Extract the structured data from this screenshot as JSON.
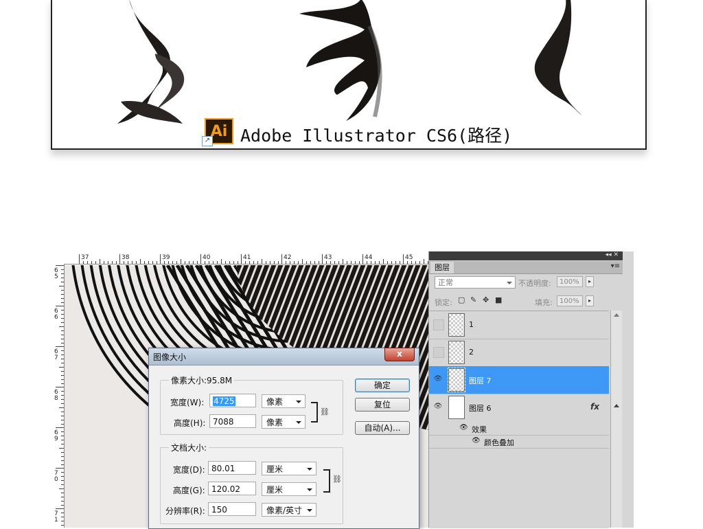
{
  "preview": {
    "app_label": "Adobe Illustrator CS6(路径)",
    "app_icon_text": "Ai",
    "app_icon": "illustrator-icon",
    "shortcut_icon": "shortcut-arrow-icon",
    "shortcut_glyph": "↗"
  },
  "rulers": {
    "top_ticks": [
      "37",
      "38",
      "39",
      "40",
      "41",
      "42",
      "43",
      "44",
      "45"
    ],
    "left_ticks": [
      [
        "6",
        "5"
      ],
      [
        "6",
        "6"
      ],
      [
        "6",
        "7"
      ],
      [
        "6",
        "8"
      ],
      [
        "6",
        "9"
      ],
      [
        "7",
        "0"
      ],
      [
        "7",
        "1"
      ]
    ]
  },
  "dialog": {
    "title": "图像大小",
    "close_glyph": "x",
    "pixel_dimensions": {
      "label": "像素大小:95.8M",
      "width_label": "宽度(W):",
      "width_value": "4725",
      "width_unit": "像素",
      "height_label": "高度(H):",
      "height_value": "7088",
      "height_unit": "像素"
    },
    "document_size": {
      "label": "文档大小:",
      "width_label": "宽度(D):",
      "width_value": "80.01",
      "width_unit": "厘米",
      "height_label": "高度(G):",
      "height_value": "120.02",
      "height_unit": "厘米",
      "resolution_label": "分辨率(R):",
      "resolution_value": "150",
      "resolution_unit": "像素/英寸"
    },
    "buttons": {
      "ok": "确定",
      "reset": "复位",
      "auto": "自动(A)..."
    }
  },
  "layers_panel": {
    "top_icons": "◂◂ ✕",
    "tab": "图层",
    "menu_glyph": "▾≡",
    "blend_mode": "正常",
    "opacity_label": "不透明度:",
    "opacity_value": "100%",
    "lock_label": "锁定:",
    "fill_label": "填充:",
    "fill_value": "100%",
    "stepper_glyph": "▸",
    "lock_icons": [
      "lock-transparent-icon",
      "lock-brush-icon",
      "lock-move-icon",
      "lock-all-icon"
    ],
    "layers": [
      {
        "name": "1",
        "visible": false,
        "selected": false,
        "thumb": "artwork"
      },
      {
        "name": "2",
        "visible": false,
        "selected": false,
        "thumb": "artwork"
      },
      {
        "name": "图层 7",
        "visible": true,
        "selected": true,
        "thumb": "artwork"
      },
      {
        "name": "图层 6",
        "visible": true,
        "selected": false,
        "thumb": "white",
        "fx": "fx"
      }
    ],
    "effects_label": "效果",
    "effect_item": "颜色叠加",
    "eye_glyph": "👁"
  }
}
